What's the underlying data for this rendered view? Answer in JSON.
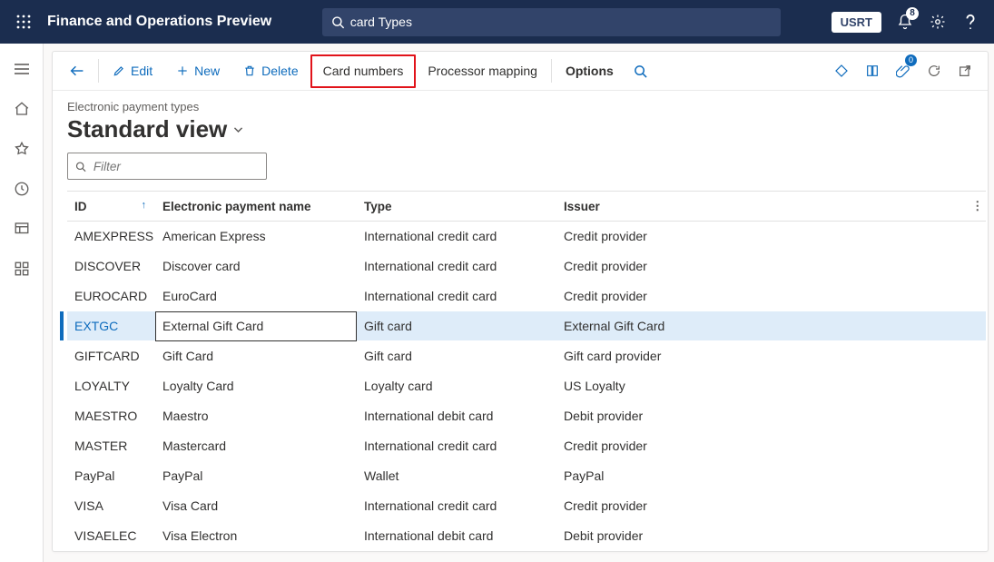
{
  "header": {
    "app_title": "Finance and Operations Preview",
    "search_value": "card Types",
    "env_label": "USRT",
    "notification_count": "8"
  },
  "actions": {
    "edit": "Edit",
    "new": "New",
    "delete": "Delete",
    "card_numbers": "Card numbers",
    "processor_mapping": "Processor mapping",
    "options": "Options",
    "attachments_count": "0"
  },
  "page": {
    "breadcrumb": "Electronic payment types",
    "view_title": "Standard view",
    "filter_placeholder": "Filter"
  },
  "grid": {
    "columns": {
      "id": "ID",
      "name": "Electronic payment name",
      "type": "Type",
      "issuer": "Issuer"
    },
    "selected_id": "EXTGC",
    "rows": [
      {
        "id": "AMEXPRESS",
        "name": "American Express",
        "type": "International credit card",
        "issuer": "Credit provider"
      },
      {
        "id": "DISCOVER",
        "name": "Discover card",
        "type": "International credit card",
        "issuer": "Credit provider"
      },
      {
        "id": "EUROCARD",
        "name": "EuroCard",
        "type": "International credit card",
        "issuer": "Credit provider"
      },
      {
        "id": "EXTGC",
        "name": "External Gift Card",
        "type": "Gift card",
        "issuer": "External Gift Card"
      },
      {
        "id": "GIFTCARD",
        "name": "Gift Card",
        "type": "Gift card",
        "issuer": "Gift card provider"
      },
      {
        "id": "LOYALTY",
        "name": "Loyalty Card",
        "type": "Loyalty card",
        "issuer": "US Loyalty"
      },
      {
        "id": "MAESTRO",
        "name": "Maestro",
        "type": "International debit card",
        "issuer": "Debit provider"
      },
      {
        "id": "MASTER",
        "name": "Mastercard",
        "type": "International credit card",
        "issuer": "Credit provider"
      },
      {
        "id": "PayPal",
        "name": "PayPal",
        "type": "Wallet",
        "issuer": "PayPal"
      },
      {
        "id": "VISA",
        "name": "Visa Card",
        "type": "International credit card",
        "issuer": "Credit provider"
      },
      {
        "id": "VISAELEC",
        "name": "Visa Electron",
        "type": "International debit card",
        "issuer": "Debit provider"
      }
    ]
  }
}
